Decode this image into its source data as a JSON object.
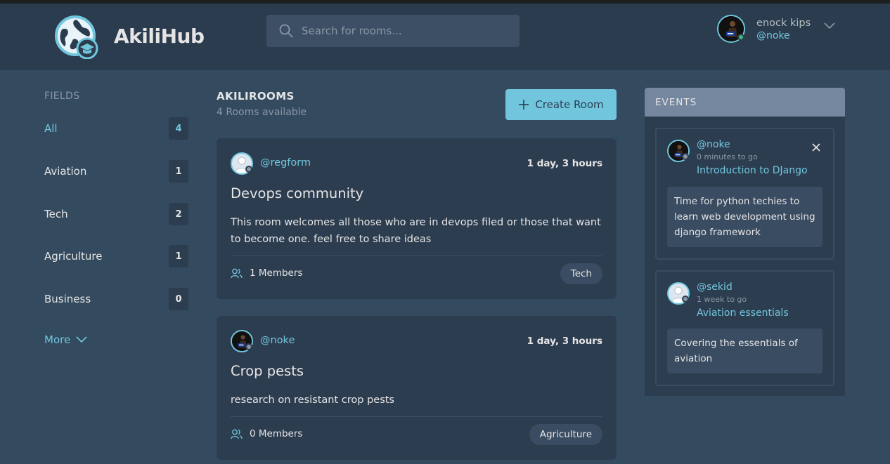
{
  "app": {
    "brand": "AkiliHub",
    "search_placeholder": "Search for rooms...",
    "user": {
      "name": "enock kips",
      "handle": "@noke"
    }
  },
  "sidebar": {
    "title": "FIELDS",
    "items": [
      {
        "label": "All",
        "count": "4",
        "active": true
      },
      {
        "label": "Aviation",
        "count": "1"
      },
      {
        "label": "Tech",
        "count": "2"
      },
      {
        "label": "Agriculture",
        "count": "1"
      },
      {
        "label": "Business",
        "count": "0"
      }
    ],
    "more_label": "More"
  },
  "main": {
    "title": "AKILIROOMS",
    "subtitle": "4 Rooms available",
    "create_label": "Create Room",
    "rooms": [
      {
        "host": "@regform",
        "time": "1 day, 3 hours",
        "title": "Devops community",
        "description": "This room welcomes all those who are in devops filed or those that want to become one. feel free to share ideas",
        "members": "1 Members",
        "topic": "Tech"
      },
      {
        "host": "@noke",
        "time": "1 day, 3 hours",
        "title": "Crop pests",
        "description": "research on resistant crop pests",
        "members": "0 Members",
        "topic": "Agriculture"
      }
    ]
  },
  "events": {
    "title": "EVENTS",
    "items": [
      {
        "host": "@noke",
        "when": "0 minutes to go",
        "title": "Introduction to DJango",
        "body": "Time for python techies to learn web development using django framework"
      },
      {
        "host": "@sekid",
        "when": "1 week to go",
        "title": "Aviation essentials",
        "body": "Covering the essentials of aviation"
      }
    ]
  },
  "colors": {
    "background": "#344a5f",
    "header": "#2c3c4f",
    "card": "#2d3d50",
    "accent": "#71c6dd",
    "events_header": "#74879f"
  }
}
